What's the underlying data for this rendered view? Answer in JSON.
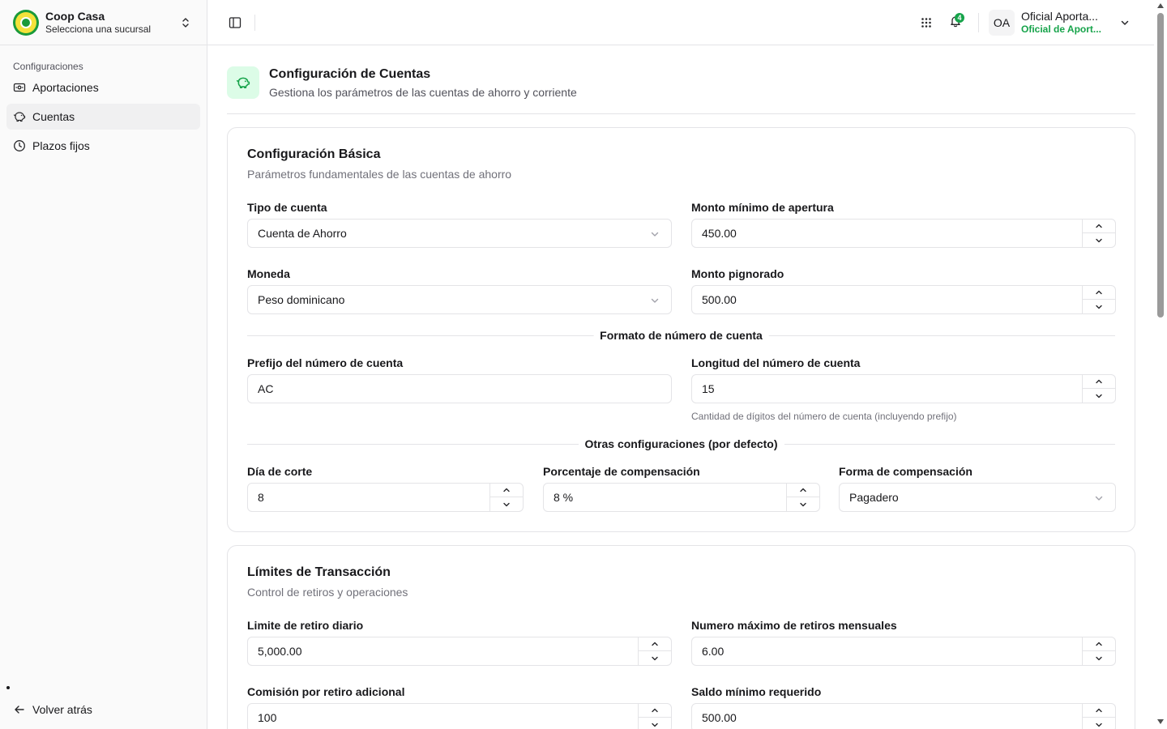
{
  "brand": {
    "name": "Coop Casa",
    "subtitle": "Selecciona una sucursal"
  },
  "sidebar": {
    "group_label": "Configuraciones",
    "items": [
      {
        "label": "Aportaciones",
        "icon": "wallet-icon",
        "active": false
      },
      {
        "label": "Cuentas",
        "icon": "piggy-bank-icon",
        "active": true
      },
      {
        "label": "Plazos fijos",
        "icon": "clock-icon",
        "active": false
      }
    ],
    "back_label": "Volver atrás"
  },
  "header": {
    "notification_count": "4",
    "user": {
      "initials": "OA",
      "name": "Oficial Aporta...",
      "role": "Oficial de Aport..."
    }
  },
  "page": {
    "title": "Configuración de Cuentas",
    "subtitle": "Gestiona los parámetros de las cuentas de ahorro y corriente"
  },
  "basic": {
    "title": "Configuración Básica",
    "subtitle": "Parámetros fundamentales de las cuentas de ahorro",
    "account_type": {
      "label": "Tipo de cuenta",
      "value": "Cuenta de Ahorro"
    },
    "min_opening": {
      "label": "Monto mínimo de apertura",
      "value": "450.00"
    },
    "currency": {
      "label": "Moneda",
      "value": "Peso dominicano"
    },
    "pledged": {
      "label": "Monto pignorado",
      "value": "500.00"
    },
    "format_section": "Formato de número de cuenta",
    "prefix": {
      "label": "Prefijo del número de cuenta",
      "value": "AC"
    },
    "length": {
      "label": "Longitud del número de cuenta",
      "value": "15",
      "hint": "Cantidad de dígitos del número de cuenta (incluyendo prefijo)"
    },
    "other_section": "Otras configuraciones (por defecto)",
    "cutoff_day": {
      "label": "Día de corte",
      "value": "8"
    },
    "comp_percent": {
      "label": "Porcentaje de compensación",
      "value": "8 %"
    },
    "comp_form": {
      "label": "Forma de compensación",
      "value": "Pagadero"
    }
  },
  "limits": {
    "title": "Límites de Transacción",
    "subtitle": "Control de retiros y operaciones",
    "daily_limit": {
      "label": "Limite de retiro diario",
      "value": "5,000.00"
    },
    "max_withdrawals": {
      "label": "Numero máximo de retiros mensuales",
      "value": "6.00"
    },
    "extra_fee": {
      "label": "Comisión por retiro adicional",
      "value": "100"
    },
    "min_balance": {
      "label": "Saldo mínimo requerido",
      "value": "500.00"
    }
  },
  "colors": {
    "accent": "#16a34a",
    "accent_bg": "#dcfce7",
    "border": "#e4e4e7"
  }
}
